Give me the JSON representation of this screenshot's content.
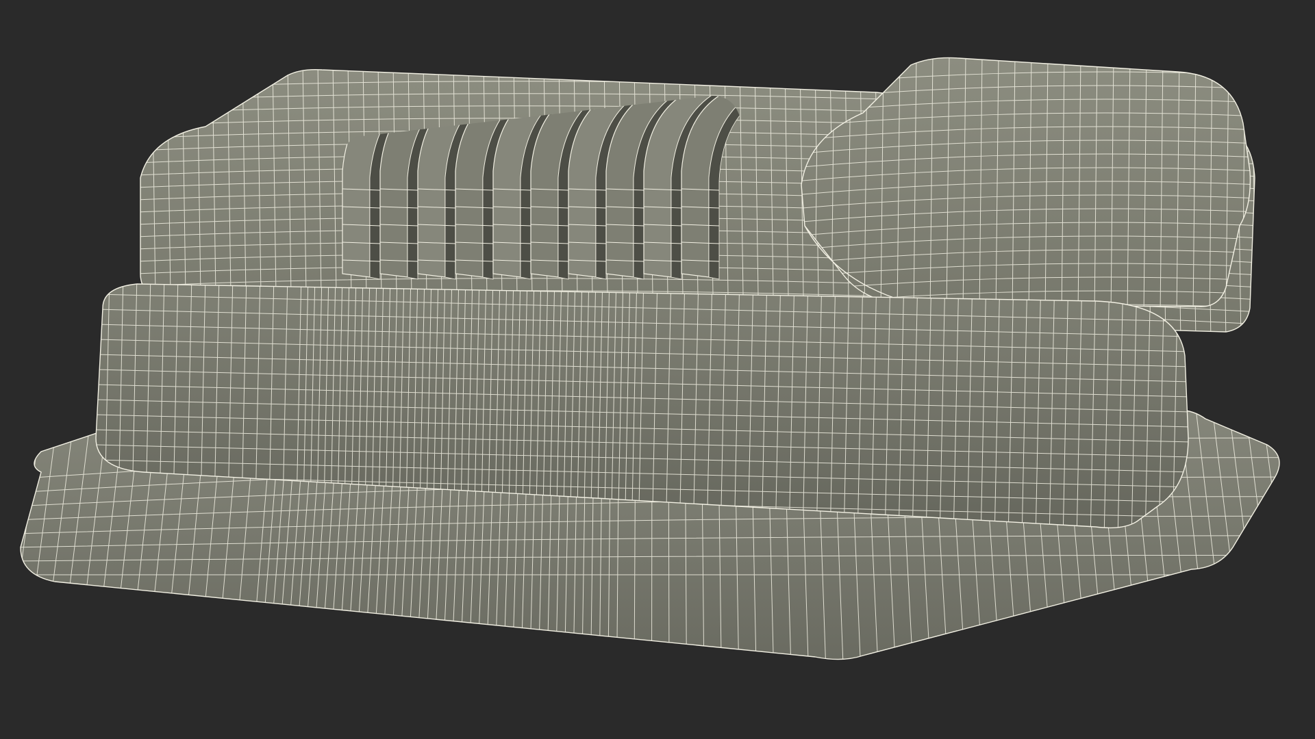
{
  "scene": {
    "subject": "wireframe-3d-model",
    "colors": {
      "background": "#2a2a2a",
      "surface_light": "#8a8b7e",
      "surface_mid": "#7b7c70",
      "surface_dark": "#5f6057",
      "wire": "#f3f1e4",
      "shadow": "#4a4b44"
    }
  }
}
